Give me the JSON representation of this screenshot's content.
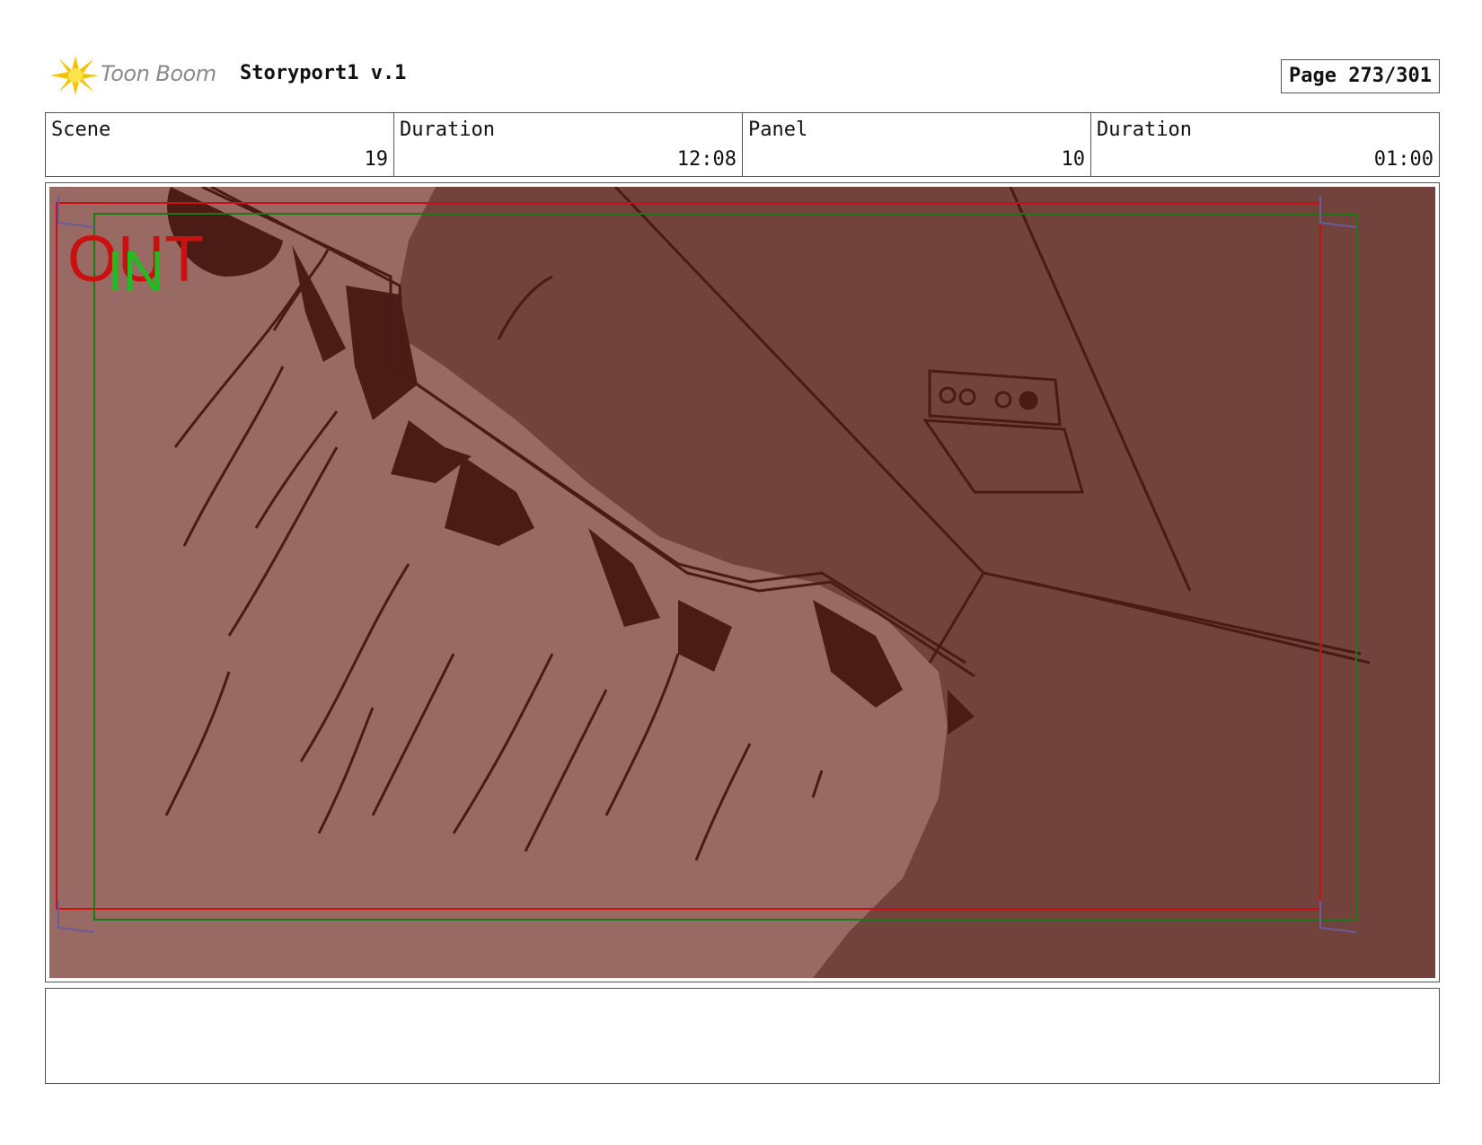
{
  "header": {
    "logo_text": "Toon Boom",
    "title": "Storyport1 v.1",
    "page_label": "Page 273/301"
  },
  "info": {
    "scene_label": "Scene",
    "scene_value": "19",
    "scene_duration_label": "Duration",
    "scene_duration_value": "12:08",
    "panel_label": "Panel",
    "panel_value": "10",
    "panel_duration_label": "Duration",
    "panel_duration_value": "01:00"
  },
  "panel": {
    "out_label": "OUT",
    "in_label": "IN",
    "colors": {
      "background": "#72433c",
      "hands": "#996a63",
      "shadow": "#4b1b16",
      "line": "#4a1a15",
      "out_frame": "#cc1010",
      "in_frame": "#1a7a1a",
      "in_text": "#22bb22"
    }
  },
  "notes": {
    "text": ""
  }
}
